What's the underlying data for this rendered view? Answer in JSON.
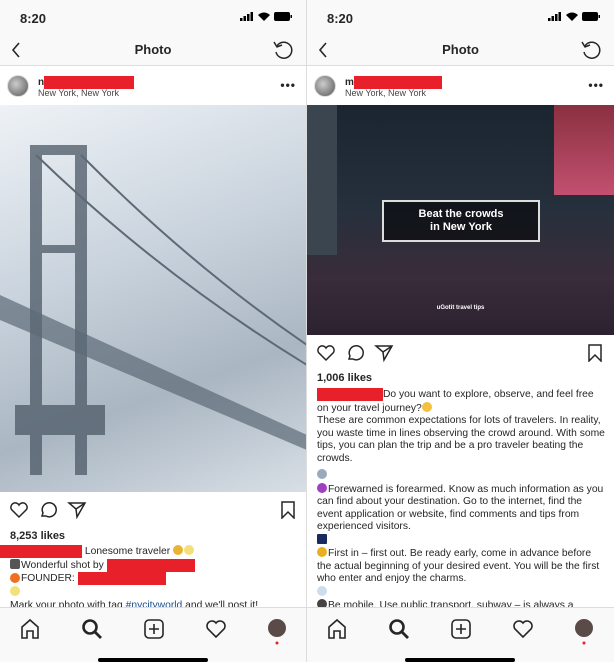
{
  "status": {
    "time": "8:20"
  },
  "nav": {
    "title": "Photo"
  },
  "colors": {
    "redaction": "#e8202a",
    "link": "#1a4f8f"
  },
  "icons": [
    "back-chevron-icon",
    "refresh-icon",
    "more-icon",
    "heart-icon",
    "comment-icon",
    "share-icon",
    "bookmark-icon",
    "home-icon",
    "search-icon",
    "add-icon",
    "activity-heart-icon",
    "profile-avatar-icon"
  ],
  "left": {
    "username_prefix": "n",
    "location": "New York, New York",
    "likes": "8,253 likes",
    "caption": {
      "line1": " Lonesome traveler",
      "line1_emoji": [
        "taxi-emoji",
        "sparkles-emoji"
      ],
      "line2": "Wonderful shot by ",
      "line2_emoji": "camera-emoji",
      "line3": "FOUNDER: ",
      "line3_emoji": "fire-emoji",
      "line4_emoji": "sparkles-emoji",
      "line5_pre": "Mark your photo with tag ",
      "line5_tag": "#nycityworld",
      "line5_post": " and we'll post it!"
    }
  },
  "right": {
    "username_prefix": "m",
    "location": "New York, New York",
    "image_title_1": "Beat the crowds",
    "image_title_2": "in New York",
    "image_credit": "uGotit travel tips",
    "likes": "1,006 likes",
    "caption": {
      "p1": "Do you want to explore, observe, and feel free on your travel journey?",
      "p2": "These are common expectations for lots of travelers. In reality, you waste time in lines observing the crowd around. With some tips, you can plan the trip and be a pro traveler beating the crowds.",
      "p3": "Forewarned is forearmed. Know as much information as you can find about your destination. Go to the internet, find the event application or website, find comments and tips from experienced visitors.",
      "p4": "First in – first out. Be ready early, come in advance before the actual beginning of your desired event. You will be the first who enter and enjoy the charms.",
      "p5": "Be mobile. Use public transport, subway – is always a"
    }
  }
}
